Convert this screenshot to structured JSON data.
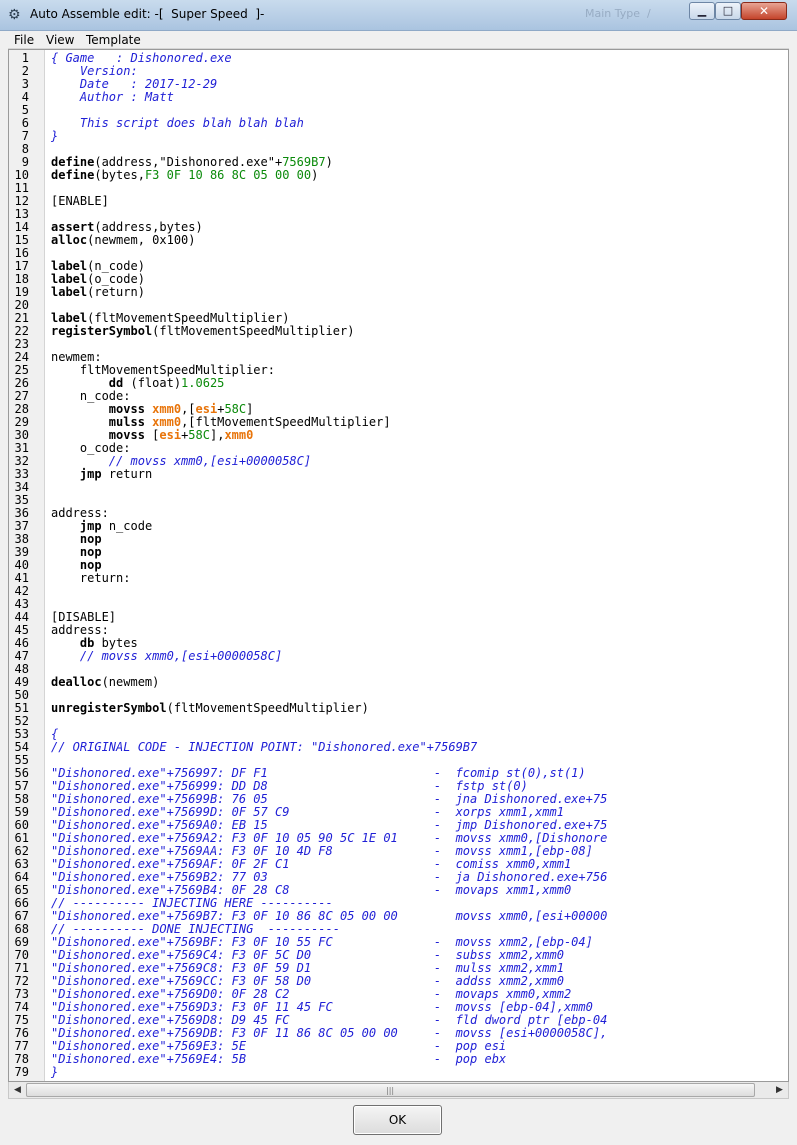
{
  "window": {
    "title": "Auto Assemble edit: -[  Super Speed  ]-",
    "background_text": "Main Type  /",
    "controls": {
      "minimize": "minimize-icon",
      "maximize": "maximize-icon",
      "close": "close-icon"
    }
  },
  "menu": [
    "File",
    "View",
    "Template"
  ],
  "ok_label": "OK",
  "colors": {
    "keyword": "#000000",
    "comment": "#1f1fd6",
    "number": "#0a8a0a",
    "register": "#e8740a",
    "close_button": "#c4442b"
  },
  "lines": [
    [
      [
        "c",
        "{ Game   : Dishonored.exe"
      ]
    ],
    [
      [
        "c",
        "    Version: "
      ]
    ],
    [
      [
        "c",
        "    Date   : 2017-12-29"
      ]
    ],
    [
      [
        "c",
        "    Author : Matt"
      ]
    ],
    [
      [
        "c",
        ""
      ]
    ],
    [
      [
        "c",
        "    This script does blah blah blah"
      ]
    ],
    [
      [
        "c",
        "}"
      ]
    ],
    [],
    [
      [
        "k",
        "define"
      ],
      [
        "t",
        "(address,\"Dishonored.exe\"+"
      ],
      [
        "n",
        "7569B7"
      ],
      [
        "t",
        ")"
      ]
    ],
    [
      [
        "k",
        "define"
      ],
      [
        "t",
        "(bytes,"
      ],
      [
        "n",
        "F3 0F 10 86 8C 05 00 00"
      ],
      [
        "t",
        ")"
      ]
    ],
    [],
    [
      [
        "t",
        "[ENABLE]"
      ]
    ],
    [],
    [
      [
        "k",
        "assert"
      ],
      [
        "t",
        "(address,bytes)"
      ]
    ],
    [
      [
        "k",
        "alloc"
      ],
      [
        "t",
        "(newmem, 0x100)"
      ]
    ],
    [],
    [
      [
        "k",
        "label"
      ],
      [
        "t",
        "(n_code)"
      ]
    ],
    [
      [
        "k",
        "label"
      ],
      [
        "t",
        "(o_code)"
      ]
    ],
    [
      [
        "k",
        "label"
      ],
      [
        "t",
        "(return)"
      ]
    ],
    [],
    [
      [
        "k",
        "label"
      ],
      [
        "t",
        "(fltMovementSpeedMultiplier)"
      ]
    ],
    [
      [
        "k",
        "registerSymbol"
      ],
      [
        "t",
        "(fltMovementSpeedMultiplier)"
      ]
    ],
    [],
    [
      [
        "t",
        "newmem:"
      ]
    ],
    [
      [
        "t",
        "    fltMovementSpeedMultiplier:"
      ]
    ],
    [
      [
        "t",
        "        "
      ],
      [
        "k",
        "dd"
      ],
      [
        "t",
        " (float)"
      ],
      [
        "n",
        "1.0625"
      ]
    ],
    [
      [
        "t",
        "    n_code:"
      ]
    ],
    [
      [
        "t",
        "        "
      ],
      [
        "k",
        "movss"
      ],
      [
        "t",
        " "
      ],
      [
        "r",
        "xmm0"
      ],
      [
        "t",
        ",["
      ],
      [
        "r",
        "esi"
      ],
      [
        "t",
        "+"
      ],
      [
        "n",
        "58C"
      ],
      [
        "t",
        "]"
      ]
    ],
    [
      [
        "t",
        "        "
      ],
      [
        "k",
        "mulss"
      ],
      [
        "t",
        " "
      ],
      [
        "r",
        "xmm0"
      ],
      [
        "t",
        ",[fltMovementSpeedMultiplier]"
      ]
    ],
    [
      [
        "t",
        "        "
      ],
      [
        "k",
        "movss"
      ],
      [
        "t",
        " ["
      ],
      [
        "r",
        "esi"
      ],
      [
        "t",
        "+"
      ],
      [
        "n",
        "58C"
      ],
      [
        "t",
        "],"
      ],
      [
        "r",
        "xmm0"
      ]
    ],
    [
      [
        "t",
        "    o_code:"
      ]
    ],
    [
      [
        "t",
        "        "
      ],
      [
        "c",
        "// movss xmm0,[esi+0000058C]"
      ]
    ],
    [
      [
        "t",
        "    "
      ],
      [
        "k",
        "jmp"
      ],
      [
        "t",
        " return"
      ]
    ],
    [],
    [],
    [
      [
        "t",
        "address:"
      ]
    ],
    [
      [
        "t",
        "    "
      ],
      [
        "k",
        "jmp"
      ],
      [
        "t",
        " n_code"
      ]
    ],
    [
      [
        "t",
        "    "
      ],
      [
        "k",
        "nop"
      ]
    ],
    [
      [
        "t",
        "    "
      ],
      [
        "k",
        "nop"
      ]
    ],
    [
      [
        "t",
        "    "
      ],
      [
        "k",
        "nop"
      ]
    ],
    [
      [
        "t",
        "    return:"
      ]
    ],
    [],
    [],
    [
      [
        "t",
        "[DISABLE]"
      ]
    ],
    [
      [
        "t",
        "address:"
      ]
    ],
    [
      [
        "t",
        "    "
      ],
      [
        "k",
        "db"
      ],
      [
        "t",
        " bytes"
      ]
    ],
    [
      [
        "t",
        "    "
      ],
      [
        "c",
        "// movss xmm0,[esi+0000058C]"
      ]
    ],
    [],
    [
      [
        "k",
        "dealloc"
      ],
      [
        "t",
        "(newmem)"
      ]
    ],
    [],
    [
      [
        "k",
        "unregisterSymbol"
      ],
      [
        "t",
        "(fltMovementSpeedMultiplier)"
      ]
    ],
    [],
    [
      [
        "c",
        "{"
      ]
    ],
    [
      [
        "c",
        "// ORIGINAL CODE - INJECTION POINT: \"Dishonored.exe\"+7569B7"
      ]
    ],
    [],
    [
      [
        "c",
        "\"Dishonored.exe\"+756997: DF F1                       -  fcomip st(0),st(1)"
      ]
    ],
    [
      [
        "c",
        "\"Dishonored.exe\"+756999: DD D8                       -  fstp st(0)"
      ]
    ],
    [
      [
        "c",
        "\"Dishonored.exe\"+75699B: 76 05                       -  jna Dishonored.exe+75"
      ]
    ],
    [
      [
        "c",
        "\"Dishonored.exe\"+75699D: 0F 57 C9                    -  xorps xmm1,xmm1"
      ]
    ],
    [
      [
        "c",
        "\"Dishonored.exe\"+7569A0: EB 15                       -  jmp Dishonored.exe+75"
      ]
    ],
    [
      [
        "c",
        "\"Dishonored.exe\"+7569A2: F3 0F 10 05 90 5C 1E 01     -  movss xmm0,[Dishonore"
      ]
    ],
    [
      [
        "c",
        "\"Dishonored.exe\"+7569AA: F3 0F 10 4D F8              -  movss xmm1,[ebp-08]"
      ]
    ],
    [
      [
        "c",
        "\"Dishonored.exe\"+7569AF: 0F 2F C1                    -  comiss xmm0,xmm1"
      ]
    ],
    [
      [
        "c",
        "\"Dishonored.exe\"+7569B2: 77 03                       -  ja Dishonored.exe+756"
      ]
    ],
    [
      [
        "c",
        "\"Dishonored.exe\"+7569B4: 0F 28 C8                    -  movaps xmm1,xmm0"
      ]
    ],
    [
      [
        "c",
        "// ---------- INJECTING HERE ----------"
      ]
    ],
    [
      [
        "c",
        "\"Dishonored.exe\"+7569B7: F3 0F 10 86 8C 05 00 00        movss xmm0,[esi+00000"
      ]
    ],
    [
      [
        "c",
        "// ---------- DONE INJECTING  ----------"
      ]
    ],
    [
      [
        "c",
        "\"Dishonored.exe\"+7569BF: F3 0F 10 55 FC              -  movss xmm2,[ebp-04]"
      ]
    ],
    [
      [
        "c",
        "\"Dishonored.exe\"+7569C4: F3 0F 5C D0                 -  subss xmm2,xmm0"
      ]
    ],
    [
      [
        "c",
        "\"Dishonored.exe\"+7569C8: F3 0F 59 D1                 -  mulss xmm2,xmm1"
      ]
    ],
    [
      [
        "c",
        "\"Dishonored.exe\"+7569CC: F3 0F 58 D0                 -  addss xmm2,xmm0"
      ]
    ],
    [
      [
        "c",
        "\"Dishonored.exe\"+7569D0: 0F 28 C2                    -  movaps xmm0,xmm2"
      ]
    ],
    [
      [
        "c",
        "\"Dishonored.exe\"+7569D3: F3 0F 11 45 FC              -  movss [ebp-04],xmm0"
      ]
    ],
    [
      [
        "c",
        "\"Dishonored.exe\"+7569D8: D9 45 FC                    -  fld dword ptr [ebp-04"
      ]
    ],
    [
      [
        "c",
        "\"Dishonored.exe\"+7569DB: F3 0F 11 86 8C 05 00 00     -  movss [esi+0000058C],"
      ]
    ],
    [
      [
        "c",
        "\"Dishonored.exe\"+7569E3: 5E                          -  pop esi"
      ]
    ],
    [
      [
        "c",
        "\"Dishonored.exe\"+7569E4: 5B                          -  pop ebx"
      ]
    ],
    [
      [
        "c",
        "}"
      ]
    ]
  ]
}
